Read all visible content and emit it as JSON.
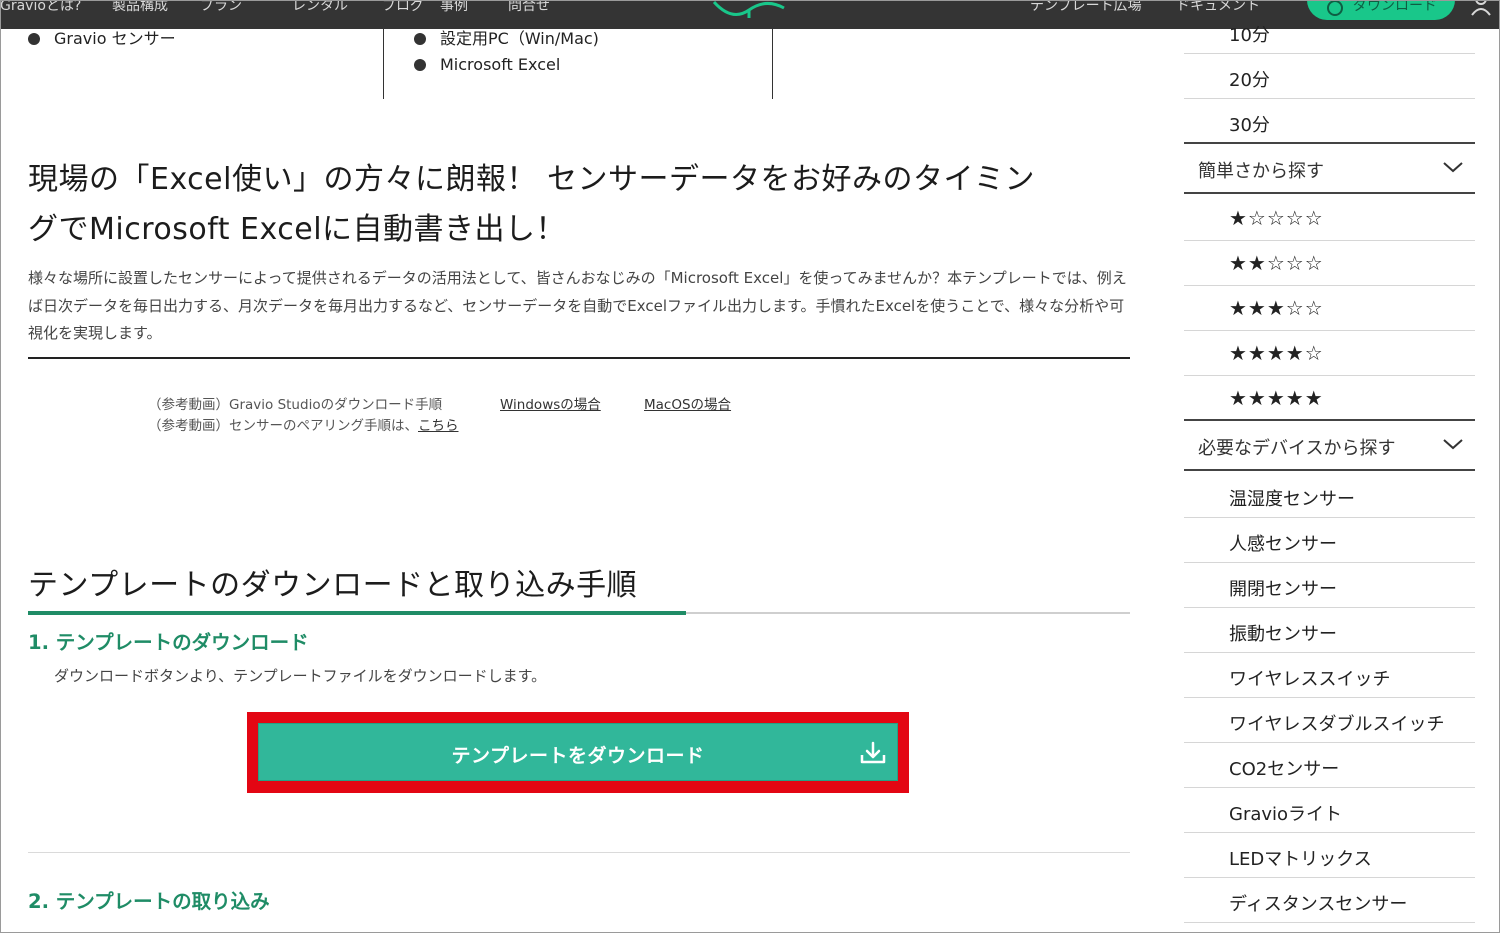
{
  "header": {
    "nav": [
      "Gravioとは?",
      "製品構成",
      "プラン",
      "レンタル",
      "ブログ",
      "事例",
      "問合せ"
    ],
    "right_nav": [
      "テンプレート広場",
      "ドキュメント"
    ],
    "download_label": "ダウンロード"
  },
  "requirements": {
    "col1": [
      "Gravio センサー"
    ],
    "col2": [
      "設定用PC（Win/Mac)",
      "Microsoft Excel"
    ]
  },
  "article": {
    "title_line1": "現場の「Excel使い」の方々に朗報！ センサーデータをお好みのタイミン",
    "title_line2": "グでMicrosoft Excelに自動書き出し！",
    "lead": "様々な場所に設置したセンサーによって提供されるデータの活用法として、皆さんおなじみの「Microsoft Excel」を使ってみませんか？本テンプレートでは、例えば日次データを毎日出力する、月次データを毎月出力するなど、センサーデータを自動でExcelファイル出力します。手慣れたExcelを使うことで、様々な分析や可視化を実現します。",
    "ref1_label": "（参考動画）Gravio Studioのダウンロード手順",
    "ref1_link_win": "Windowsの場合",
    "ref1_link_mac": "MacOSの場合",
    "ref2_label": "（参考動画）センサーのペアリング手順は、",
    "ref2_link": "こちら",
    "section_title": "テンプレートのダウンロードと取り込み手順",
    "step1_title": "1. テンプレートのダウンロード",
    "step1_desc": "ダウンロードボタンより、テンプレートファイルをダウンロードします。",
    "download_button": "テンプレートをダウンロード",
    "step2_title": "2. テンプレートの取り込み"
  },
  "sidebar": {
    "time_items": [
      "10分",
      "20分",
      "30分"
    ],
    "difficulty_header": "簡単さから探す",
    "stars": [
      "★☆☆☆☆",
      "★★☆☆☆",
      "★★★☆☆",
      "★★★★☆",
      "★★★★★"
    ],
    "device_header": "必要なデバイスから探す",
    "devices": [
      "温湿度センサー",
      "人感センサー",
      "開閉センサー",
      "振動センサー",
      "ワイヤレススイッチ",
      "ワイヤレスダブルスイッチ",
      "CO2センサー",
      "Gravioライト",
      "LEDマトリックス",
      "ディスタンスセンサー"
    ]
  },
  "colors": {
    "accent_green": "#1f8c66",
    "button_green": "#31b79a",
    "highlight_red": "#e30613",
    "header_bg": "#343434"
  }
}
